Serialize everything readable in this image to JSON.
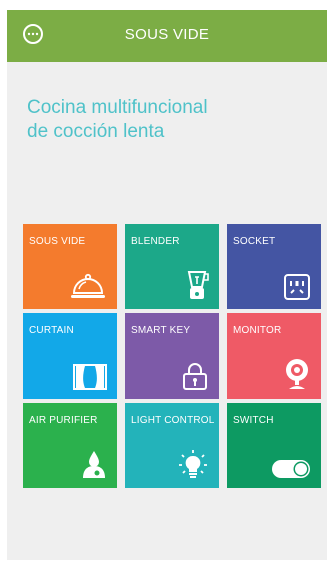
{
  "header": {
    "title": "SOUS VIDE",
    "menu_icon": "more-options-icon",
    "background": "#7cad45"
  },
  "headline": {
    "line1": "Cocina multifuncional",
    "line2": "de cocción lenta",
    "color": "#4fc2c9"
  },
  "tiles": [
    {
      "label": "SOUS VIDE",
      "icon": "cloche-icon",
      "color": "#f47b2d"
    },
    {
      "label": "BLENDER",
      "icon": "blender-icon",
      "color": "#1ca889"
    },
    {
      "label": "SOCKET",
      "icon": "socket-icon",
      "color": "#4455a3"
    },
    {
      "label": "CURTAIN",
      "icon": "curtain-icon",
      "color": "#12a8e8"
    },
    {
      "label": "SMART KEY",
      "icon": "padlock-icon",
      "color": "#7d5aa8"
    },
    {
      "label": "MONITOR",
      "icon": "webcam-icon",
      "color": "#ef5a66"
    },
    {
      "label": "AIR PURIFIER",
      "icon": "humidifier-icon",
      "color": "#2bb14d"
    },
    {
      "label": "LIGHT CONTROL",
      "icon": "light-bulb-icon",
      "color": "#23b3ba"
    },
    {
      "label": "SWITCH",
      "icon": "toggle-switch-icon",
      "color": "#0d9a62"
    }
  ]
}
